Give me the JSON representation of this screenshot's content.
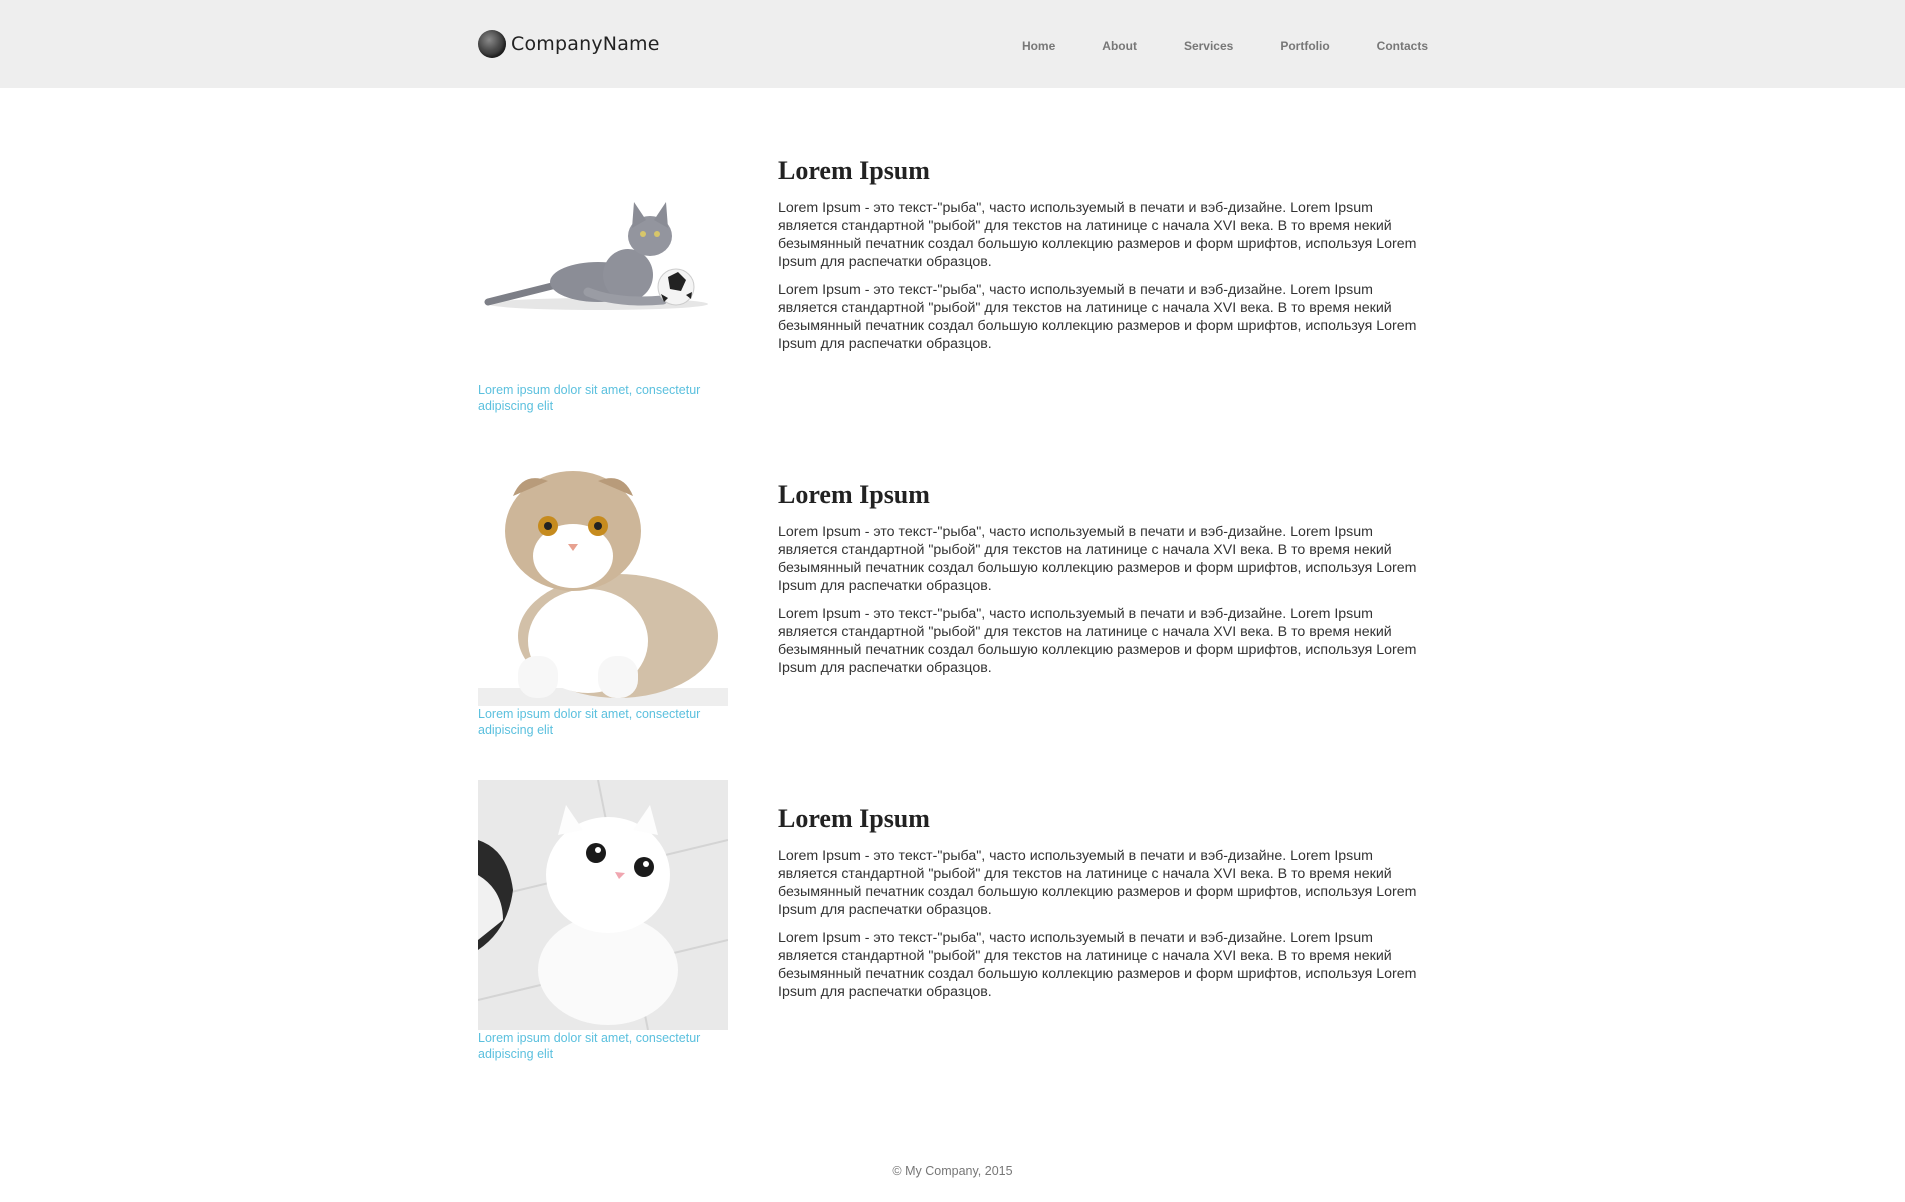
{
  "header": {
    "logo_text": "CompanyName",
    "nav": [
      {
        "label": "Home"
      },
      {
        "label": "About"
      },
      {
        "label": "Services"
      },
      {
        "label": "Portfolio"
      },
      {
        "label": "Contacts"
      }
    ]
  },
  "items": [
    {
      "image": "gray-kitten-with-ball",
      "caption": "Lorem ipsum dolor sit amet, consectetur adipiscing elit",
      "title": "Lorem Ipsum",
      "paragraphs": [
        "Lorem Ipsum - это текст-\"рыба\", часто используемый в печати и вэб-дизайне. Lorem Ipsum является стандартной \"рыбой\" для текстов на латинице с начала XVI века. В то время некий безымянный печатник создал большую коллекцию размеров и форм шрифтов, используя Lorem Ipsum для распечатки образцов.",
        "Lorem Ipsum - это текст-\"рыба\", часто используемый в печати и вэб-дизайне. Lorem Ipsum является стандартной \"рыбой\" для текстов на латинице с начала XVI века. В то время некий безымянный печатник создал большую коллекцию размеров и форм шрифтов, используя Lorem Ipsum для распечатки образцов."
      ]
    },
    {
      "image": "scottish-fold-cat",
      "caption": "Lorem ipsum dolor sit amet, consectetur adipiscing elit",
      "title": "Lorem Ipsum",
      "paragraphs": [
        "Lorem Ipsum - это текст-\"рыба\", часто используемый в печати и вэб-дизайне. Lorem Ipsum является стандартной \"рыбой\" для текстов на латинице с начала XVI века. В то время некий безымянный печатник создал большую коллекцию размеров и форм шрифтов, используя Lorem Ipsum для распечатки образцов.",
        "Lorem Ipsum - это текст-\"рыба\", часто используемый в печати и вэб-дизайне. Lorem Ipsum является стандартной \"рыбой\" для текстов на латинице с начала XVI века. В то время некий безымянный печатник создал большую коллекцию размеров и форм шрифтов, используя Lorem Ipsum для распечатки образцов."
      ]
    },
    {
      "image": "white-persian-kitten",
      "caption": "Lorem ipsum dolor sit amet, consectetur adipiscing elit",
      "title": "Lorem Ipsum",
      "paragraphs": [
        "Lorem Ipsum - это текст-\"рыба\", часто используемый в печати и вэб-дизайне. Lorem Ipsum является стандартной \"рыбой\" для текстов на латинице с начала XVI века. В то время некий безымянный печатник создал большую коллекцию размеров и форм шрифтов, используя Lorem Ipsum для распечатки образцов.",
        "Lorem Ipsum - это текст-\"рыба\", часто используемый в печати и вэб-дизайне. Lorem Ipsum является стандартной \"рыбой\" для текстов на латинице с начала XVI века. В то время некий безымянный печатник создал большую коллекцию размеров и форм шрифтов, используя Lorem Ipsum для распечатки образцов."
      ]
    }
  ],
  "footer": {
    "copyright": "© My Company, 2015"
  },
  "colors": {
    "header_bg": "#eeeeee",
    "caption_link": "#5bc0de",
    "nav_text": "#777777"
  }
}
